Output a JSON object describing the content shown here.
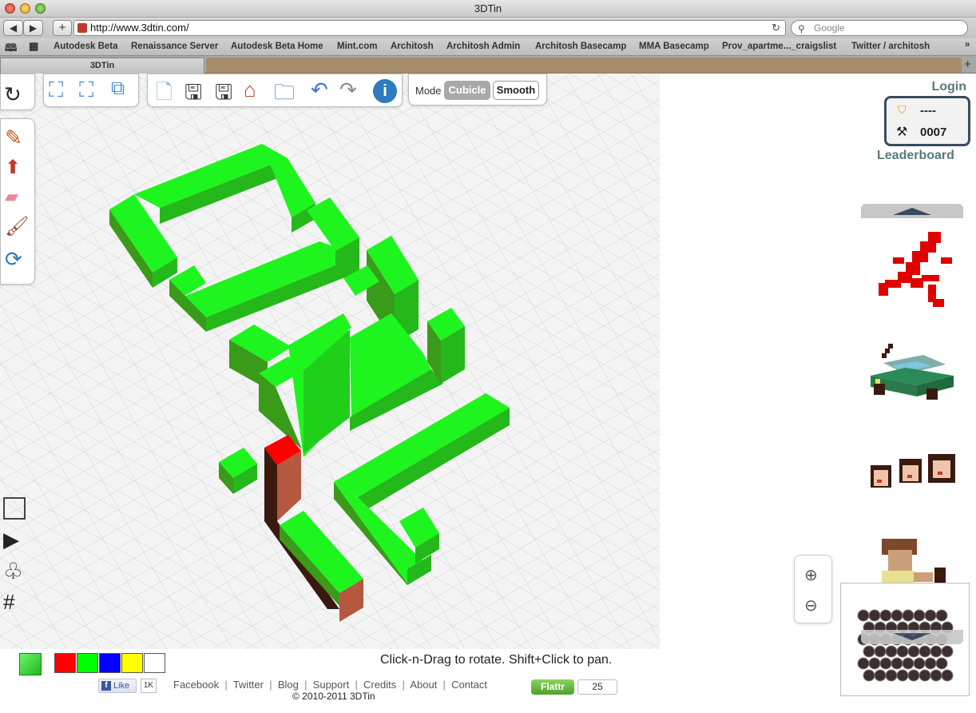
{
  "window": {
    "title": "3DTin"
  },
  "nav": {
    "back": "◀",
    "forward": "▶",
    "add": "+",
    "url": "http://www.3dtin.com/",
    "reload": "C",
    "search_placeholder": "Google"
  },
  "bookmarks": [
    "Autodesk Beta",
    "Renaissance Server",
    "Autodesk Beta Home",
    "Mint.com",
    "Architosh",
    "Architosh Admin",
    "Architosh Basecamp",
    "MMA Basecamp",
    "Prov_apartme..._craigslist",
    "Twitter / architosh"
  ],
  "tabs": [
    {
      "label": "3DTin"
    }
  ],
  "toolbar": {
    "mode_label": "Mode",
    "cubicle_label": "Cubicle",
    "smooth_label": "Smooth"
  },
  "account": {
    "login": "Login",
    "rank": "----",
    "score": "0007",
    "leaderboard": "Leaderboard"
  },
  "palette": {
    "current": "#2ecc40",
    "colors": [
      "#ff0000",
      "#00ff00",
      "#0000ff",
      "#ffff00",
      "#ffffff"
    ]
  },
  "hint": "Click-n-Drag to rotate. Shift+Click to pan.",
  "social": {
    "like_label": "Like",
    "like_count": "1K",
    "flattr_label": "Flattr",
    "flattr_count": "25"
  },
  "footer": {
    "links": [
      "Facebook",
      "Twitter",
      "Blog",
      "Support",
      "Credits",
      "About",
      "Contact"
    ],
    "copyright": "© 2010-2011 3DTin"
  }
}
